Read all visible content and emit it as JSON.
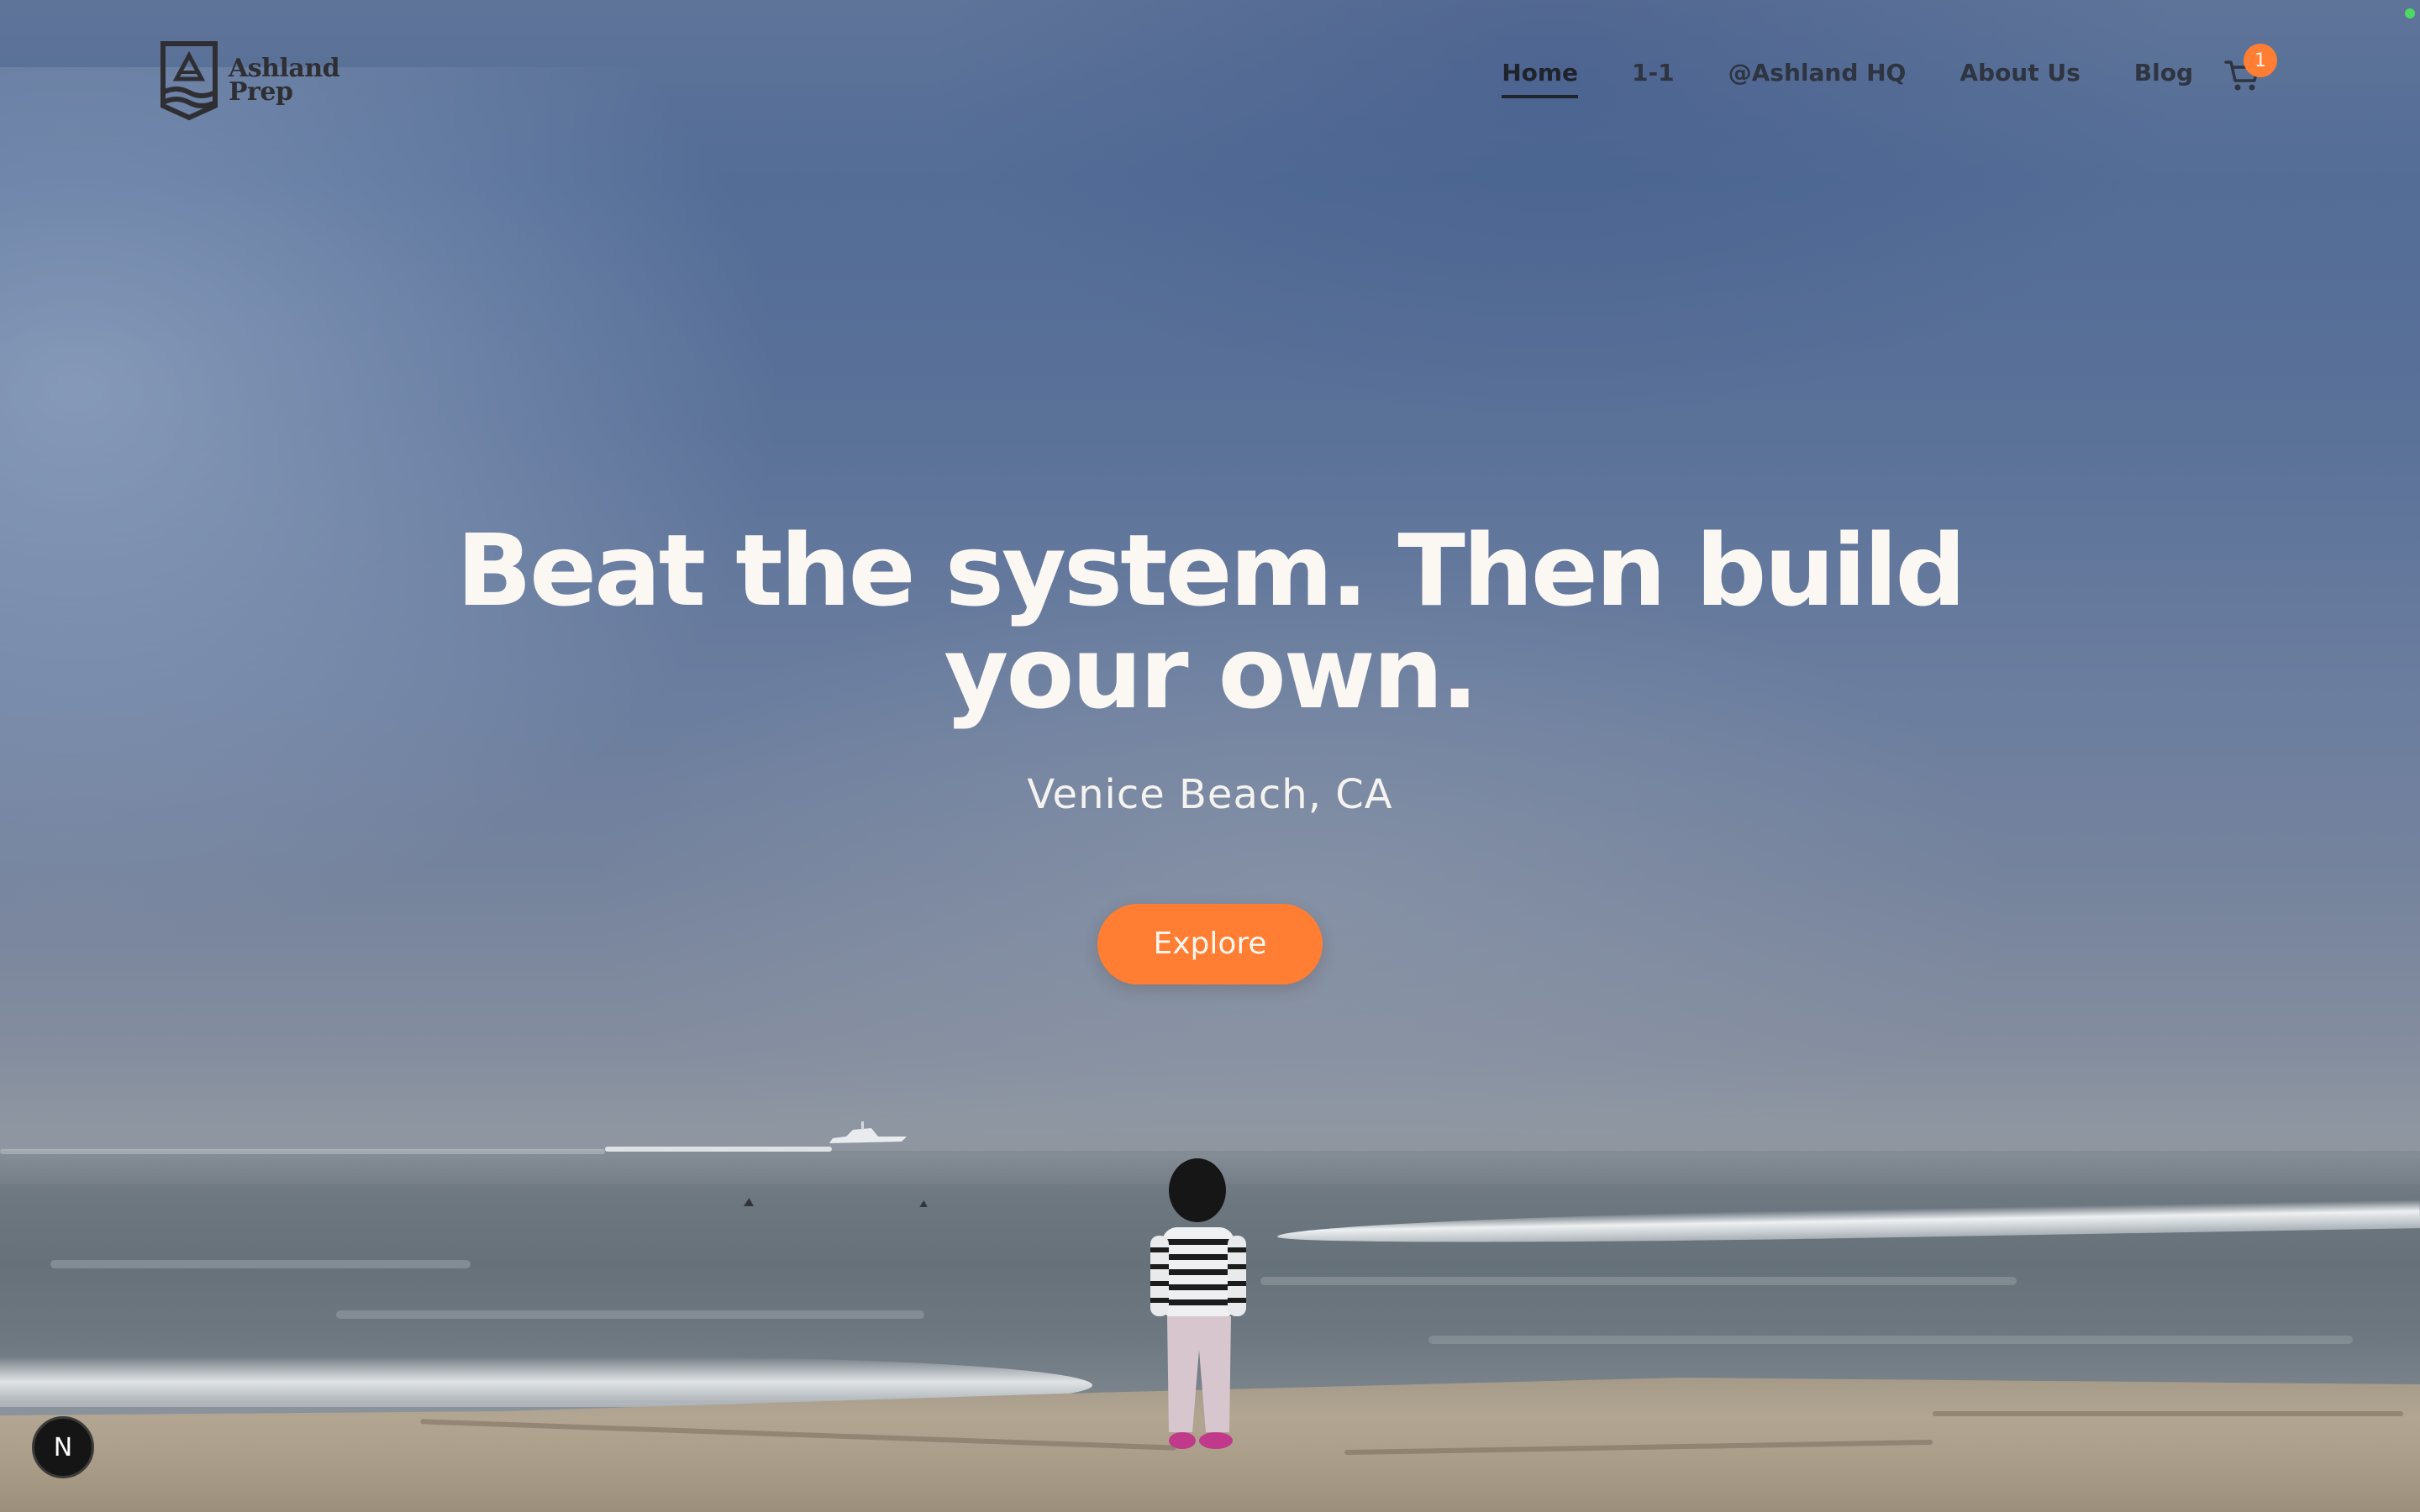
{
  "brand": {
    "line1": "Ashland",
    "line2": "Prep",
    "logo_icon": "ashland-shield-logo"
  },
  "nav": {
    "items": [
      {
        "label": "Home",
        "active": true
      },
      {
        "label": "1-1",
        "active": false
      },
      {
        "label": "@Ashland HQ",
        "active": false
      },
      {
        "label": "About Us",
        "active": false
      },
      {
        "label": "Blog",
        "active": false
      }
    ],
    "cart_icon": "shopping-cart-icon",
    "cart_count": "1"
  },
  "hero": {
    "title_line1": "Beat the system. Then build",
    "title_line2": "your own.",
    "subtitle": "Venice Beach, CA",
    "cta_label": "Explore"
  },
  "dev_badge": {
    "label": "N",
    "icon": "nextjs-dev-indicator-icon"
  },
  "colors": {
    "accent": "#ff7e33",
    "nav_text": "#2e3440",
    "hero_text": "#fbf7f3",
    "status_dot": "#4cd964"
  }
}
